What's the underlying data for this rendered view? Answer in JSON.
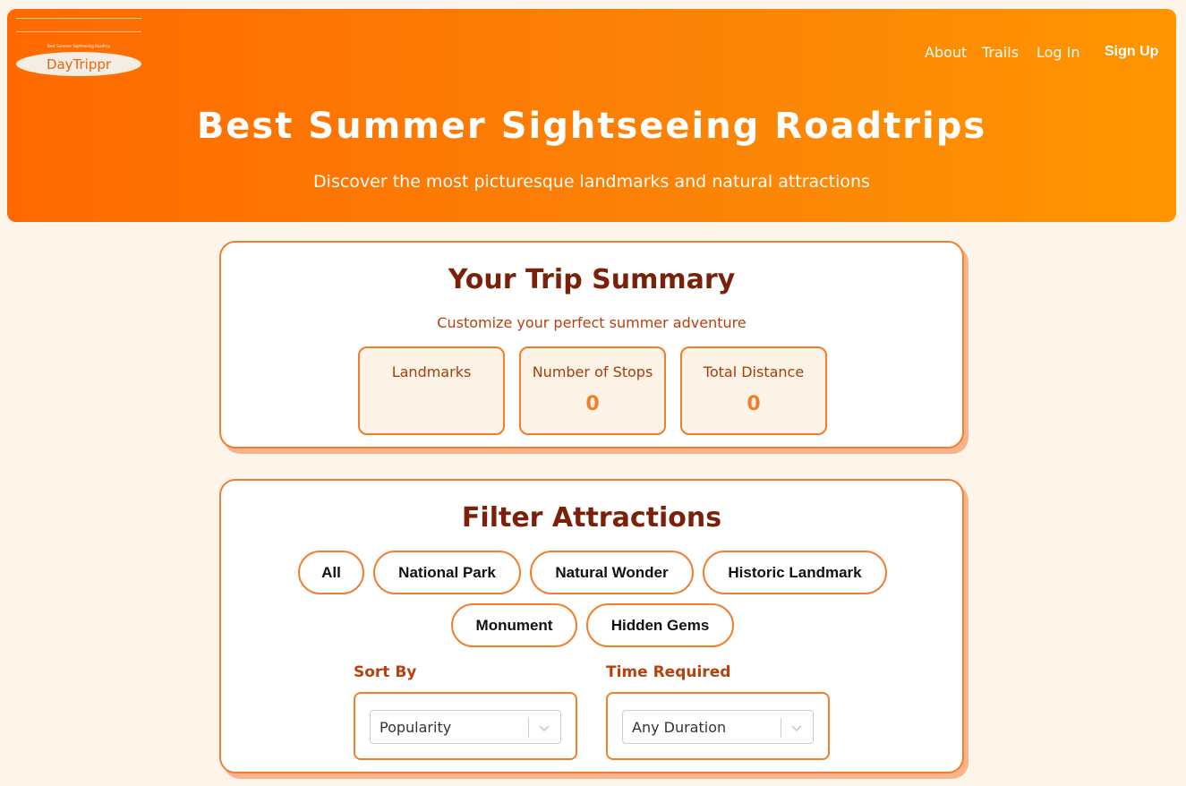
{
  "brand": {
    "tagline": "Best Summer Sightseeing Roadtrip",
    "name": "DayTrippr"
  },
  "nav": {
    "about": "About",
    "trails": "Trails",
    "login": "Log In",
    "signup": "Sign Up"
  },
  "hero": {
    "title": "Best Summer Sightseeing Roadtrips",
    "subtitle": "Discover the most picturesque landmarks and natural attractions"
  },
  "summary": {
    "title": "Your Trip Summary",
    "subtitle": "Customize your perfect summer adventure",
    "stats": [
      {
        "label": "Landmarks",
        "value": ""
      },
      {
        "label": "Number of Stops",
        "value": "0"
      },
      {
        "label": "Total Distance",
        "value": "0"
      }
    ]
  },
  "filters": {
    "title": "Filter Attractions",
    "categories": [
      "All",
      "National Park",
      "Natural Wonder",
      "Historic Landmark",
      "Monument",
      "Hidden Gems"
    ],
    "sort_label": "Sort By",
    "sort_value": "Popularity",
    "time_label": "Time Required",
    "time_value": "Any Duration"
  },
  "colors": {
    "accent": "#f27d2a",
    "heading": "#7b210a",
    "background": "#fdf4ea"
  }
}
